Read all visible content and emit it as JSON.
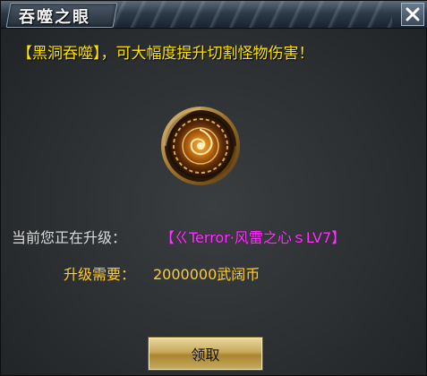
{
  "window": {
    "title": "吞噬之眼",
    "close_icon": "close-icon"
  },
  "message": {
    "headline": "【黑洞吞噬】，可大幅度提升切割怪物伤害！"
  },
  "emblem": {
    "icon": "black-hole-emblem-icon"
  },
  "upgrade": {
    "label": "当前您正在升级：",
    "skill_name": "【ㄍTerror·风雷之心ｓLV7】",
    "cost_label": "升级需要：",
    "cost_value": "2000000武阔币"
  },
  "actions": {
    "claim_label": "领取"
  },
  "colors": {
    "headline": "#ffe400",
    "skill_name": "#ff33ff",
    "cost": "#ffcc33",
    "label": "#d9d9d9"
  }
}
